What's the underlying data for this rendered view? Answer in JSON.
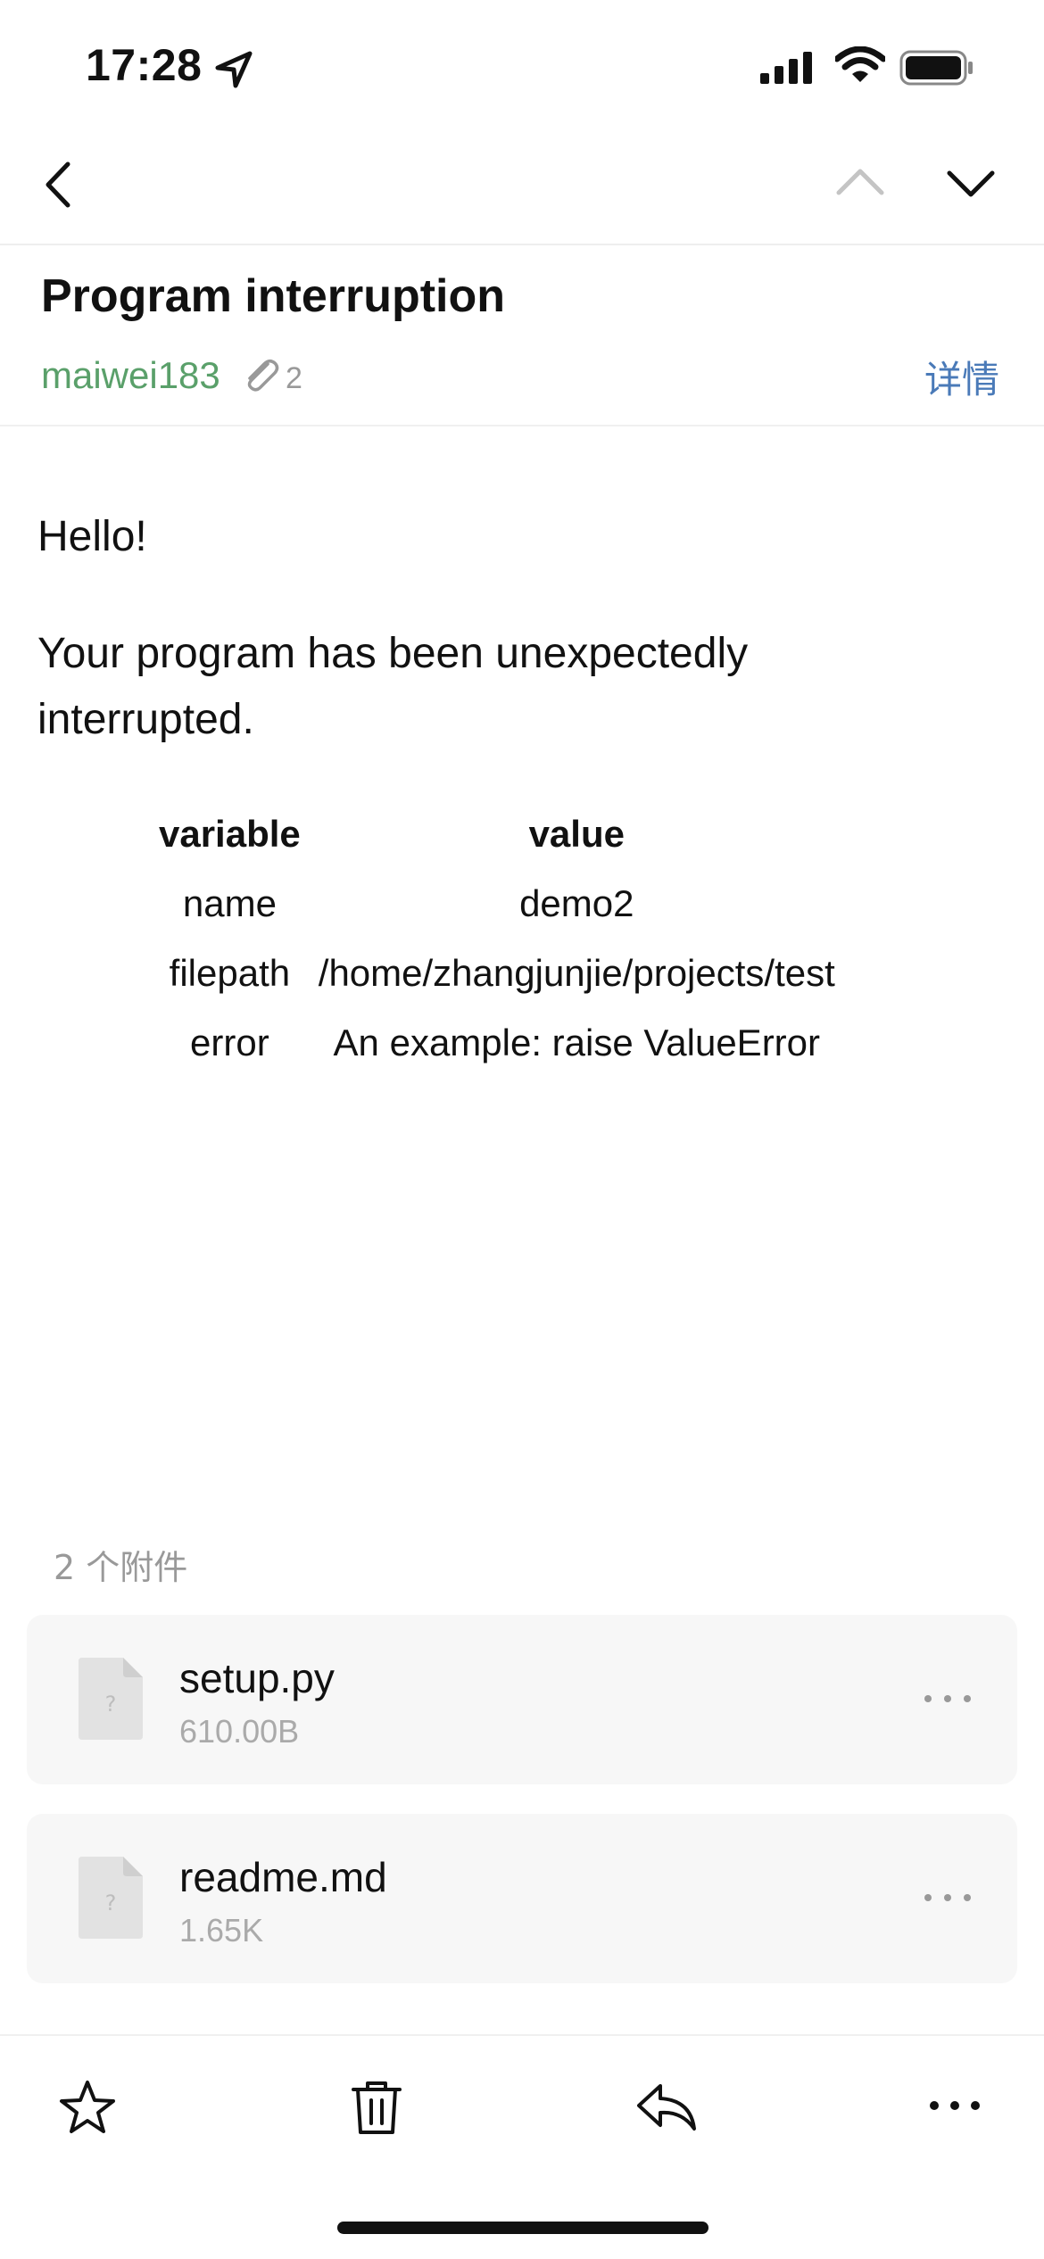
{
  "status_bar": {
    "time": "17:28",
    "icons": [
      "location-arrow-icon",
      "cellular-signal-icon",
      "wifi-icon",
      "battery-icon"
    ]
  },
  "nav": {
    "icons": [
      "chevron-left-icon",
      "chevron-up-icon",
      "chevron-down-icon"
    ]
  },
  "email": {
    "subject": "Program interruption",
    "sender": "maiwei183",
    "attachment_count": "2",
    "details_label": "详情",
    "greeting": "Hello!",
    "paragraph": "Your program has been unexpectedly interrupted.",
    "table": {
      "headers": [
        "variable",
        "value"
      ],
      "rows": [
        [
          "name",
          "demo2"
        ],
        [
          "filepath",
          "/home/zhangjunjie/projects/test"
        ],
        [
          "error",
          "An example: raise ValueError"
        ]
      ]
    }
  },
  "attachments": {
    "header": "2 个附件",
    "items": [
      {
        "name": "setup.py",
        "size": "610.00B"
      },
      {
        "name": "readme.md",
        "size": "1.65K"
      }
    ]
  },
  "toolbar": {
    "icons": [
      "star-icon",
      "trash-icon",
      "reply-icon",
      "more-icon"
    ]
  },
  "colors": {
    "sender": "#5aa06a",
    "link": "#4a7ab8",
    "muted": "#999999",
    "card_bg": "#f7f7f7"
  }
}
